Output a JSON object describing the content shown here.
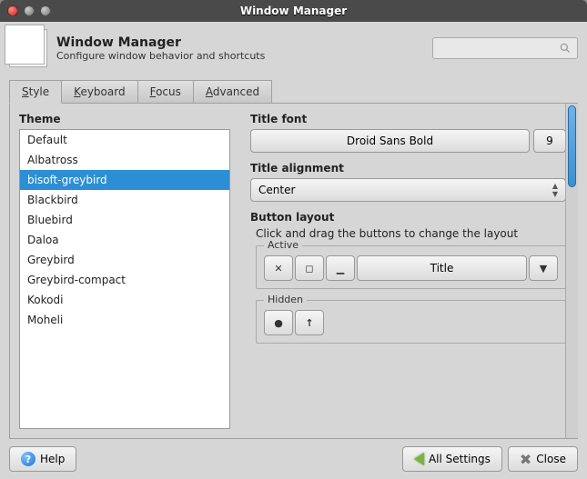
{
  "window": {
    "title": "Window Manager"
  },
  "header": {
    "title": "Window Manager",
    "subtitle": "Configure window behavior and shortcuts"
  },
  "tabs": [
    {
      "label": "Style",
      "mnemonic": "S",
      "rest": "tyle"
    },
    {
      "label": "Keyboard",
      "mnemonic": "K",
      "rest": "eyboard"
    },
    {
      "label": "Focus",
      "mnemonic": "F",
      "rest": "ocus"
    },
    {
      "label": "Advanced",
      "mnemonic": "A",
      "rest": "dvanced"
    }
  ],
  "theme": {
    "label": "Theme",
    "items": [
      "Default",
      "Albatross",
      "bisoft-greybird",
      "Blackbird",
      "Bluebird",
      "Daloa",
      "Greybird",
      "Greybird-compact",
      "Kokodi",
      "Moheli"
    ],
    "selected": "bisoft-greybird"
  },
  "titleFont": {
    "label": "Title font",
    "name": "Droid Sans Bold",
    "size": "9"
  },
  "titleAlign": {
    "label": "Title alignment",
    "value": "Center"
  },
  "buttonLayout": {
    "label": "Button layout",
    "hint": "Click and drag the buttons to change the layout",
    "active": {
      "legend": "Active",
      "title": "Title"
    },
    "hidden": {
      "legend": "Hidden"
    }
  },
  "footer": {
    "help": "Help",
    "allSettings": "All Settings",
    "close": "Close"
  }
}
